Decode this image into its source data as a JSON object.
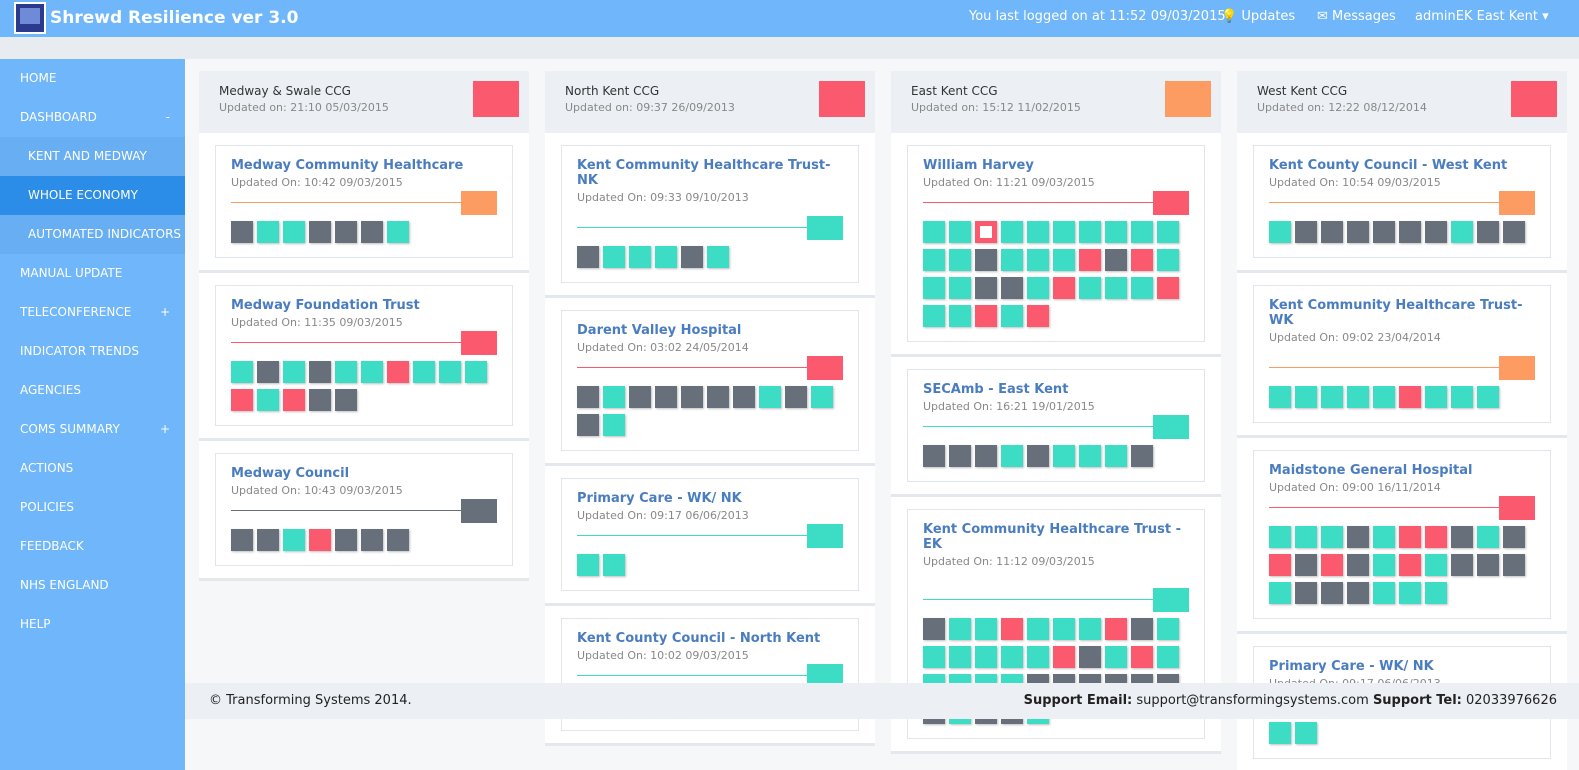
{
  "app": {
    "title": "Shrewd Resilience ver 3.0",
    "last_login": "You last logged on at 11:52 09/03/2015",
    "updates": "Updates",
    "messages": "Messages",
    "user": "adminEK East Kent"
  },
  "sidebar": {
    "items": [
      {
        "label": "HOME",
        "tog": ""
      },
      {
        "label": "DASHBOARD",
        "tog": "-"
      },
      {
        "label": "KENT AND MEDWAY",
        "tog": ""
      },
      {
        "label": "WHOLE ECONOMY",
        "tog": ""
      },
      {
        "label": "AUTOMATED INDICATORS",
        "tog": ""
      },
      {
        "label": "MANUAL UPDATE",
        "tog": ""
      },
      {
        "label": "TELECONFERENCE",
        "tog": "+"
      },
      {
        "label": "INDICATOR TRENDS",
        "tog": ""
      },
      {
        "label": "AGENCIES",
        "tog": ""
      },
      {
        "label": "COMS SUMMARY",
        "tog": "+"
      },
      {
        "label": "ACTIONS",
        "tog": ""
      },
      {
        "label": "POLICIES",
        "tog": ""
      },
      {
        "label": "FEEDBACK",
        "tog": ""
      },
      {
        "label": "NHS ENGLAND",
        "tog": ""
      },
      {
        "label": "HELP",
        "tog": ""
      }
    ]
  },
  "columns": [
    {
      "title": "Medway & Swale CCG",
      "updated": "Updated on: 21:10 05/03/2015",
      "status": "r",
      "cards": [
        {
          "name": "Medway Community Healthcare",
          "updated": "Updated On: 10:42 09/03/2015",
          "status": "o",
          "tiles": "dggdddg"
        },
        {
          "name": "Medway Foundation Trust",
          "updated": "Updated On: 11:35 09/03/2015",
          "status": "r",
          "tiles": "gdgdggrgggrgrdd"
        },
        {
          "name": "Medway Council",
          "updated": "Updated On: 10:43 09/03/2015",
          "status": "d",
          "tiles": "ddgrddd"
        }
      ]
    },
    {
      "title": "North Kent CCG",
      "updated": "Updated on: 09:37 26/09/2013",
      "status": "r",
      "cards": [
        {
          "name": "Kent Community Healthcare Trust- NK",
          "updated": "Updated On: 09:33 09/10/2013",
          "status": "g",
          "tiles": "dgggdg",
          "spacer": true
        },
        {
          "name": "Darent Valley Hospital",
          "updated": "Updated On: 03:02 24/05/2014",
          "status": "r",
          "tiles": "dgdddddgdgdg"
        },
        {
          "name": "Primary Care - WK/ NK",
          "updated": "Updated On: 09:17 06/06/2013",
          "status": "g",
          "tiles": "gg"
        },
        {
          "name": "Kent County Council - North Kent",
          "updated": "Updated On: 10:02 09/03/2015",
          "status": "g",
          "tiles": "gdrgg"
        }
      ]
    },
    {
      "title": "East Kent CCG",
      "updated": "Updated on: 15:12 11/02/2015",
      "status": "o",
      "cards": [
        {
          "name": "William Harvey",
          "updated": "Updated On: 11:21 09/03/2015",
          "status": "r",
          "tiles": "ggsgggggggggdgggrdrgggddgrgggrggrgr",
          "sel": 2
        },
        {
          "name": "SECAmb - East Kent",
          "updated": "Updated On: 16:21 19/01/2015",
          "status": "g",
          "tiles": "dddgdgggd"
        },
        {
          "name": "Kent Community Healthcare Trust -EK",
          "updated": "Updated On: 11:12 09/03/2015",
          "status": "g",
          "tiles": "dggrgggrdggggggrdgrgggggdddddddgddg",
          "spacer": true
        }
      ]
    },
    {
      "title": "West Kent CCG",
      "updated": "Updated on: 12:22 08/12/2014",
      "status": "r",
      "cards": [
        {
          "name": "Kent County Council - West Kent",
          "updated": "Updated On: 10:54 09/03/2015",
          "status": "o",
          "tiles": "gddddddgdd"
        },
        {
          "name": "Kent Community Healthcare Trust- WK",
          "updated": "Updated On: 09:02 23/04/2014",
          "status": "o",
          "tiles": "gggggrggg",
          "spacer": true
        },
        {
          "name": "Maidstone General Hospital",
          "updated": "Updated On: 09:00 16/11/2014",
          "status": "r",
          "tiles": "gggdgrrdgdrdrdgrgdddgdddggg"
        },
        {
          "name": "Primary Care - WK/ NK",
          "updated": "Updated On: 09:17 06/06/2013",
          "status": "g",
          "tiles": "gg"
        }
      ]
    }
  ],
  "colors": {
    "g": "#3ddcc4",
    "d": "#666f7a",
    "r": "#fb5a6e",
    "o": "#fd9c62"
  },
  "footer": {
    "copyright": "© Transforming Systems 2014.",
    "email_label": "Support Email:",
    "email": "support@transformingsystems.com",
    "tel_label": "Support Tel:",
    "tel": "02033976626"
  }
}
